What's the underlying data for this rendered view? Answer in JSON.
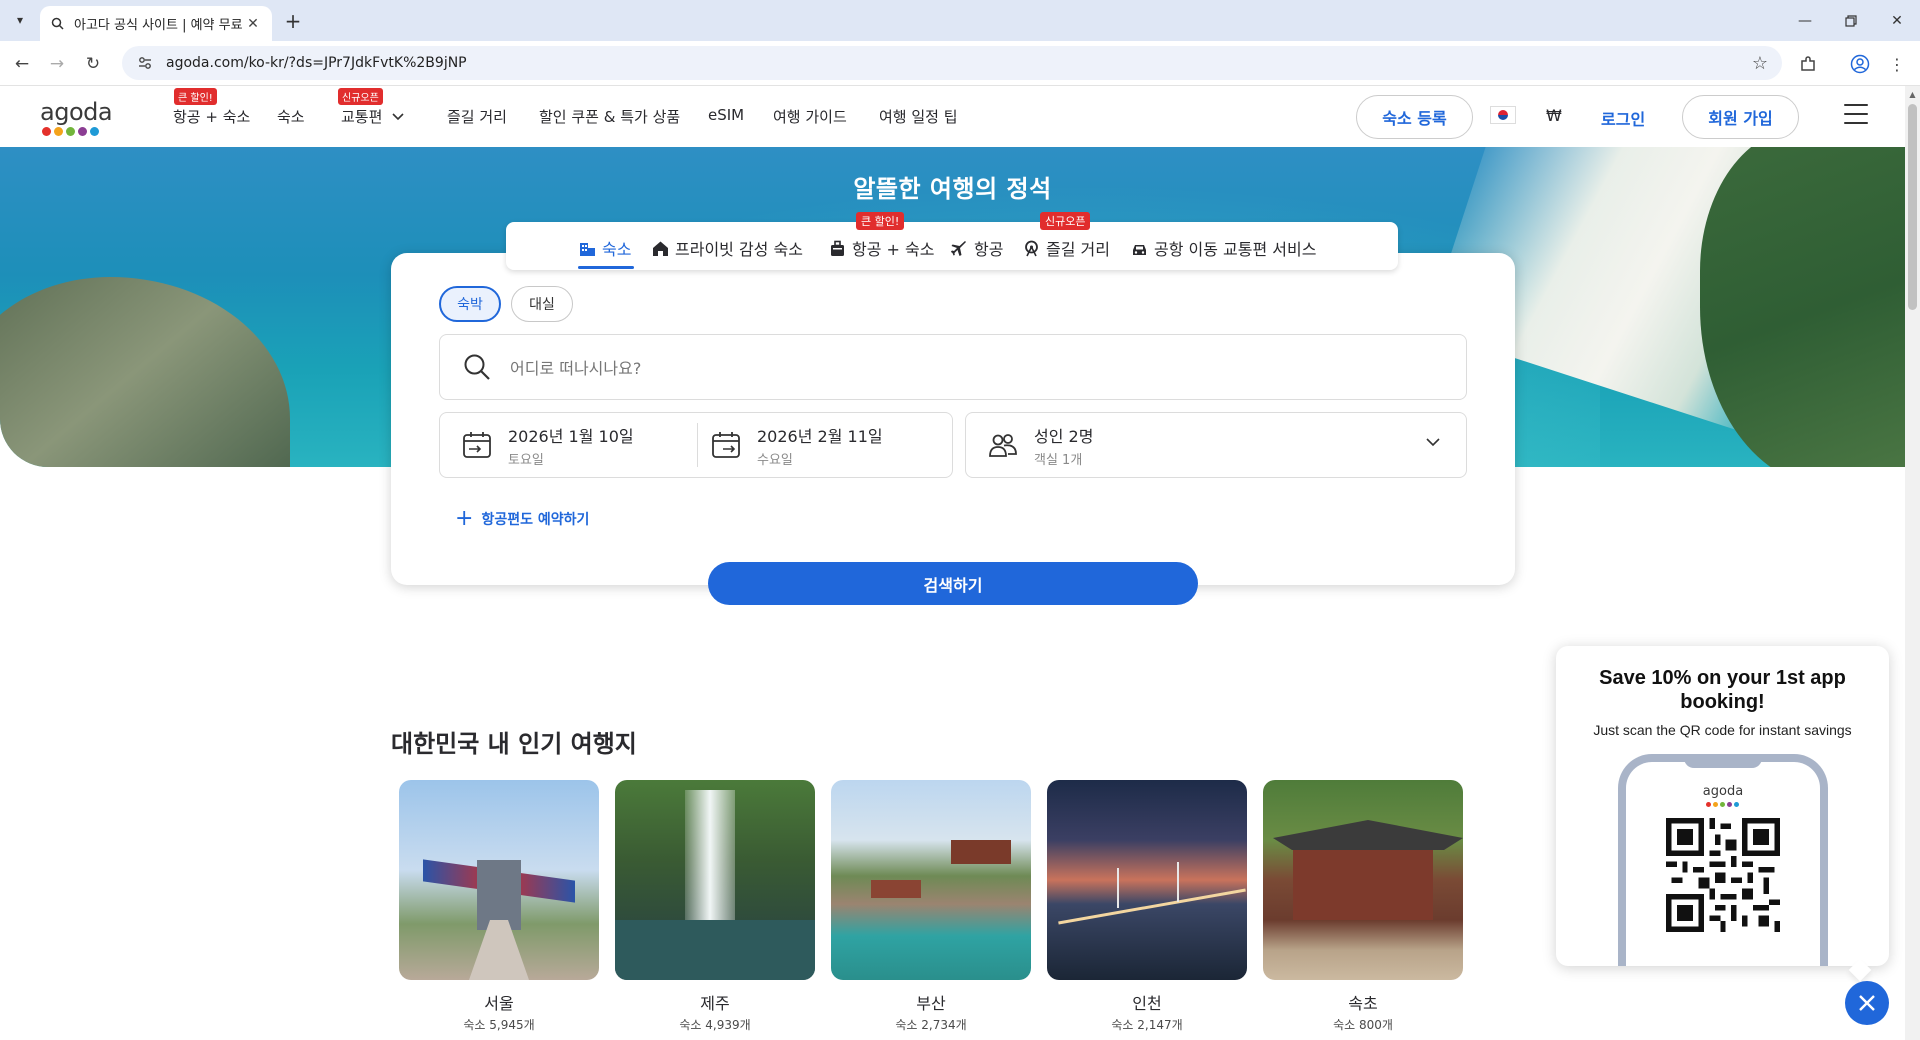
{
  "browser": {
    "tab_title": "아고다 공식 사이트 | 예약 무료",
    "url": "agoda.com/ko-kr/?ds=JPr7JdkFvtK%2B9jNP"
  },
  "header": {
    "logo_text": "agoda",
    "logo_colors": [
      "#e4312b",
      "#f4a31b",
      "#72b53b",
      "#8b3d93",
      "#1f9ad6"
    ],
    "nav": [
      {
        "label": "항공 + 숙소",
        "badge": "큰 할인!"
      },
      {
        "label": "숙소",
        "badge": ""
      },
      {
        "label": "교통편",
        "badge": "신규오픈"
      },
      {
        "label": "즐길 거리",
        "badge": ""
      },
      {
        "label": "할인 쿠폰 & 특가 상품",
        "badge": ""
      },
      {
        "label": "eSIM",
        "badge": ""
      },
      {
        "label": "여행 가이드",
        "badge": ""
      },
      {
        "label": "여행 일정 팁",
        "badge": ""
      }
    ],
    "list_property": "숙소 등록",
    "currency": "₩",
    "login": "로그인",
    "signup": "회원 가입"
  },
  "hero": {
    "title": "알뜰한 여행의 정석"
  },
  "search": {
    "tabs": [
      {
        "label": "숙소",
        "badge": "",
        "icon": "hotel-icon"
      },
      {
        "label": "프라이빗 감성 숙소",
        "badge": "",
        "icon": "home-icon"
      },
      {
        "label": "항공 + 숙소",
        "badge": "큰 할인!",
        "icon": "luggage-icon"
      },
      {
        "label": "항공",
        "badge": "",
        "icon": "plane-icon"
      },
      {
        "label": "즐길 거리",
        "badge": "신규오픈",
        "icon": "ferris-wheel-icon"
      },
      {
        "label": "공항 이동 교통편 서비스",
        "badge": "",
        "icon": "car-icon"
      }
    ],
    "stay_type": {
      "overnight": "숙박",
      "day_use": "대실"
    },
    "destination_placeholder": "어디로 떠나시나요?",
    "checkin": {
      "date": "2026년 1월 10일",
      "weekday": "토요일"
    },
    "checkout": {
      "date": "2026년 2월 11일",
      "weekday": "수요일"
    },
    "guests": {
      "main": "성인 2명",
      "rooms": "객실 1개"
    },
    "add_flight": "항공편도 예약하기",
    "button": "검색하기"
  },
  "popular": {
    "title": "대한민국 내 인기 여행지",
    "items": [
      {
        "name": "서울",
        "count": "숙소 5,945개"
      },
      {
        "name": "제주",
        "count": "숙소 4,939개"
      },
      {
        "name": "부산",
        "count": "숙소 2,734개"
      },
      {
        "name": "인천",
        "count": "숙소 2,147개"
      },
      {
        "name": "속초",
        "count": "숙소 800개"
      }
    ]
  },
  "promo": {
    "heading": "Save 10% on your 1st app booking!",
    "subtext": "Just scan the QR code for instant savings",
    "phone_logo": "agoda"
  },
  "colors": {
    "brand_blue": "#2067da",
    "badge_red": "#e12d2d"
  }
}
